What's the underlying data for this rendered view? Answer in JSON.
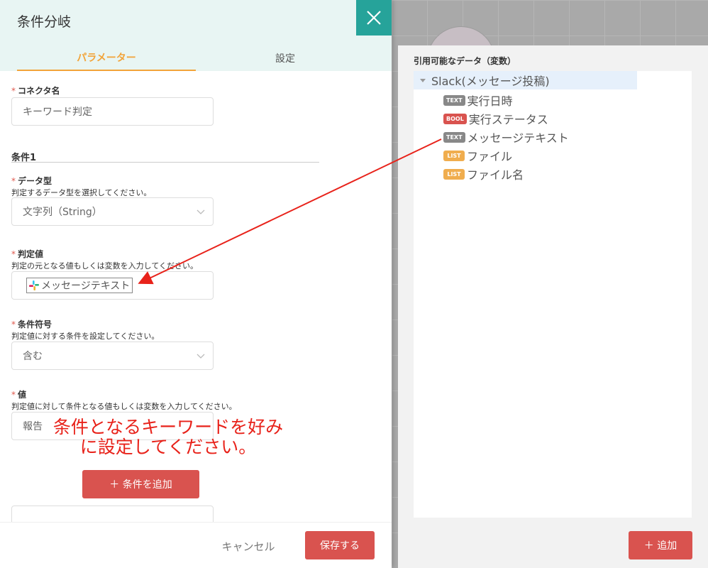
{
  "drawer": {
    "title": "条件分岐",
    "tabs": {
      "params": "パラメーター",
      "settings": "設定"
    }
  },
  "form": {
    "connector_name": {
      "label": "コネクタ名",
      "value": "キーワード判定"
    },
    "section": "条件1",
    "data_type": {
      "label": "データ型",
      "help": "判定するデータ型を選択してください。",
      "value": "文字列（String）"
    },
    "judge_value": {
      "label": "判定値",
      "help": "判定の元となる値もしくは変数を入力してください。",
      "chip": "メッセージテキスト"
    },
    "operator": {
      "label": "条件符号",
      "help": "判定値に対する条件を設定してください。",
      "value": "含む"
    },
    "value": {
      "label": "値",
      "help": "判定値に対して条件となる値もしくは変数を入力してください。",
      "value": "報告"
    },
    "add_condition": "＋ 条件を追加",
    "required_mark": "*"
  },
  "annotation": {
    "line1": "条件となるキーワードを好み",
    "line2": "に設定してください。",
    "color": "#e8221a"
  },
  "footer": {
    "cancel": "キャンセル",
    "save": "保存する"
  },
  "variables": {
    "title": "引用可能なデータ（変数）",
    "root": "Slack(メッセージ投稿)",
    "items": [
      {
        "badge": "TEXT",
        "label": "実行日時"
      },
      {
        "badge": "BOOL",
        "label": "実行ステータス"
      },
      {
        "badge": "TEXT",
        "label": "メッセージテキスト"
      },
      {
        "badge": "LIST",
        "label": "ファイル"
      },
      {
        "badge": "LIST",
        "label": "ファイル名"
      }
    ],
    "add": "＋ 追加"
  },
  "colors": {
    "accent": "#f2a43a",
    "primary": "#d9534f",
    "teal": "#26a39a",
    "header_bg": "#e8f5f3"
  }
}
